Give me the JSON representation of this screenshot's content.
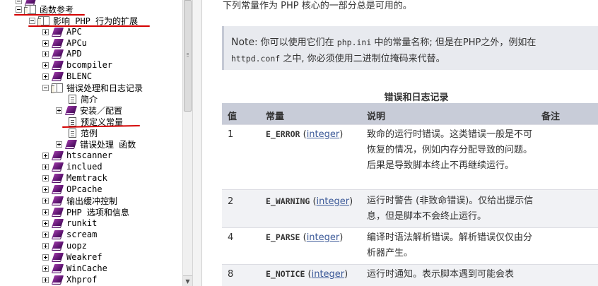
{
  "tree": {
    "items": [
      {
        "label": "函数参考",
        "icon": "open-book-icon",
        "expander": "minus"
      },
      {
        "label": "影响 PHP 行为的扩展",
        "icon": "open-book-icon",
        "expander": "minus"
      },
      {
        "label": "APC",
        "icon": "closed-book-icon",
        "expander": "plus"
      },
      {
        "label": "APCu",
        "icon": "closed-book-icon",
        "expander": "plus"
      },
      {
        "label": "APD",
        "icon": "closed-book-icon",
        "expander": "plus"
      },
      {
        "label": "bcompiler",
        "icon": "closed-book-icon",
        "expander": "plus"
      },
      {
        "label": "BLENC",
        "icon": "closed-book-icon",
        "expander": "plus"
      },
      {
        "label": "错误处理和日志记录",
        "icon": "open-book-icon",
        "expander": "minus"
      },
      {
        "label": "简介",
        "icon": "page-icon",
        "expander": "none"
      },
      {
        "label": "安装／配置",
        "icon": "closed-book-icon",
        "expander": "plus"
      },
      {
        "label": "预定义常量",
        "icon": "page-icon",
        "expander": "none"
      },
      {
        "label": "范例",
        "icon": "page-icon",
        "expander": "none"
      },
      {
        "label": "错误处理 函数",
        "icon": "closed-book-icon",
        "expander": "plus"
      },
      {
        "label": "htscanner",
        "icon": "closed-book-icon",
        "expander": "plus"
      },
      {
        "label": "inclued",
        "icon": "closed-book-icon",
        "expander": "plus"
      },
      {
        "label": "Memtrack",
        "icon": "closed-book-icon",
        "expander": "plus"
      },
      {
        "label": "OPcache",
        "icon": "closed-book-icon",
        "expander": "plus"
      },
      {
        "label": "输出缓冲控制",
        "icon": "closed-book-icon",
        "expander": "plus"
      },
      {
        "label": "PHP 选项和信息",
        "icon": "closed-book-icon",
        "expander": "plus"
      },
      {
        "label": "runkit",
        "icon": "closed-book-icon",
        "expander": "plus"
      },
      {
        "label": "scream",
        "icon": "closed-book-icon",
        "expander": "plus"
      },
      {
        "label": "uopz",
        "icon": "closed-book-icon",
        "expander": "plus"
      },
      {
        "label": "Weakref",
        "icon": "closed-book-icon",
        "expander": "plus"
      },
      {
        "label": "WinCache",
        "icon": "closed-book-icon",
        "expander": "plus"
      },
      {
        "label": "Xhprof",
        "icon": "closed-book-icon",
        "expander": "plus"
      }
    ]
  },
  "content": {
    "intro": "下列常量作为 PHP 核心的一部分总是可用的。",
    "note": {
      "label": "Note",
      "text1": ": 你可以使用它们在 ",
      "code1": "php.ini",
      "text2": " 中的常量名称; 但是在PHP之外，例如在",
      "code2": "httpd.conf",
      "text3": " 之中, 你必须使用二进制位掩码来代替。"
    },
    "table": {
      "caption": "错误和日志记录",
      "headers": [
        "值",
        "常量",
        "说明",
        "备注"
      ],
      "rows": [
        {
          "value": "1",
          "constant": "E_ERROR",
          "type": "integer",
          "desc": "致命的运行时错误。这类错误一般是不可恢复的情况，例如内存分配导致的问题。后果是导致脚本终止不再继续运行。"
        },
        {
          "value": "2",
          "constant": "E_WARNING",
          "type": "integer",
          "desc": "运行时警告 (非致命错误)。仅给出提示信息，但是脚本不会终止运行。"
        },
        {
          "value": "4",
          "constant": "E_PARSE",
          "type": "integer",
          "desc": "编译时语法解析错误。解析错误仅仅由分析器产生。"
        },
        {
          "value": "8",
          "constant": "E_NOTICE",
          "type": "integer",
          "desc": "运行时通知。表示脚本遇到可能会表"
        }
      ]
    }
  },
  "colors": {
    "annotation": "#d40000",
    "book": "#5d1470",
    "table_header": "#c8ccd8",
    "note_bg": "#e8eaef",
    "link": "#3b5998"
  }
}
